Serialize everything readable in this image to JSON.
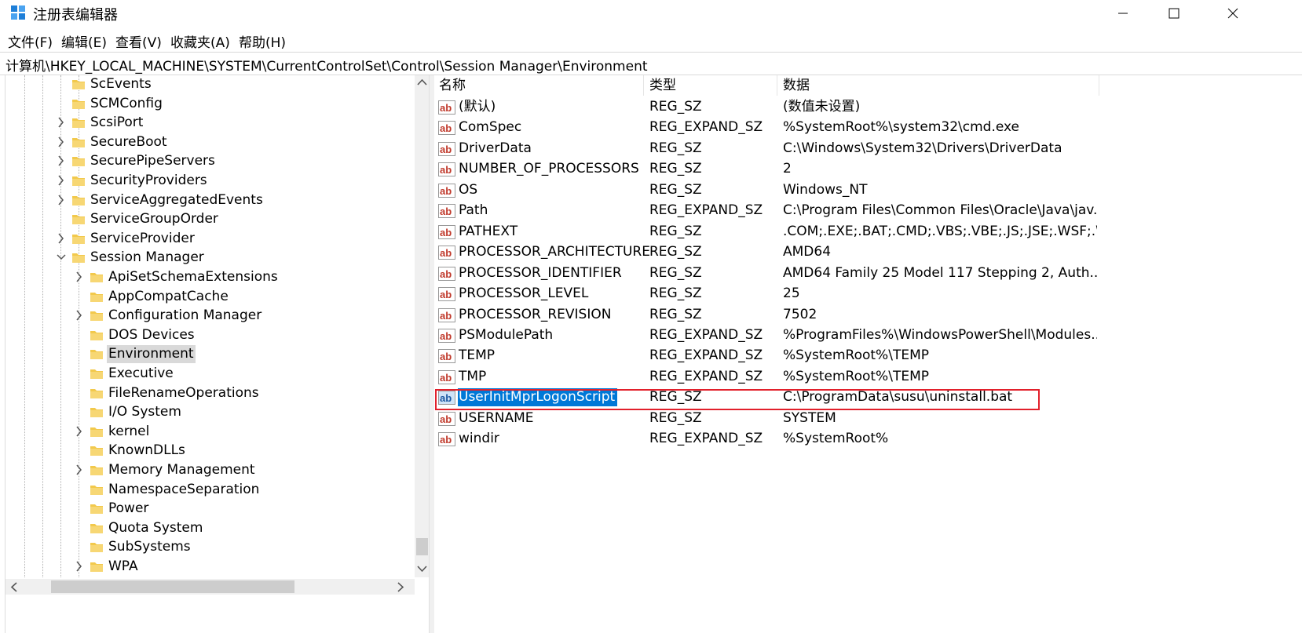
{
  "window": {
    "title": "注册表编辑器",
    "icon": "regedit-icon"
  },
  "menu": [
    "文件(F)",
    "编辑(E)",
    "查看(V)",
    "收藏夹(A)",
    "帮助(H)"
  ],
  "address": "计算机\\HKEY_LOCAL_MACHINE\\SYSTEM\\CurrentControlSet\\Control\\Session Manager\\Environment",
  "tree": [
    {
      "label": "ScEvents",
      "level": 0,
      "expander": "none"
    },
    {
      "label": "SCMConfig",
      "level": 0,
      "expander": "none"
    },
    {
      "label": "ScsiPort",
      "level": 0,
      "expander": "collapsed"
    },
    {
      "label": "SecureBoot",
      "level": 0,
      "expander": "collapsed"
    },
    {
      "label": "SecurePipeServers",
      "level": 0,
      "expander": "collapsed"
    },
    {
      "label": "SecurityProviders",
      "level": 0,
      "expander": "collapsed"
    },
    {
      "label": "ServiceAggregatedEvents",
      "level": 0,
      "expander": "collapsed"
    },
    {
      "label": "ServiceGroupOrder",
      "level": 0,
      "expander": "none"
    },
    {
      "label": "ServiceProvider",
      "level": 0,
      "expander": "collapsed"
    },
    {
      "label": "Session Manager",
      "level": 0,
      "expander": "expanded"
    },
    {
      "label": "ApiSetSchemaExtensions",
      "level": 1,
      "expander": "collapsed"
    },
    {
      "label": "AppCompatCache",
      "level": 1,
      "expander": "none"
    },
    {
      "label": "Configuration Manager",
      "level": 1,
      "expander": "collapsed"
    },
    {
      "label": "DOS Devices",
      "level": 1,
      "expander": "none"
    },
    {
      "label": "Environment",
      "level": 1,
      "expander": "none",
      "selected": true
    },
    {
      "label": "Executive",
      "level": 1,
      "expander": "none"
    },
    {
      "label": "FileRenameOperations",
      "level": 1,
      "expander": "none"
    },
    {
      "label": "I/O System",
      "level": 1,
      "expander": "none"
    },
    {
      "label": "kernel",
      "level": 1,
      "expander": "collapsed"
    },
    {
      "label": "KnownDLLs",
      "level": 1,
      "expander": "none"
    },
    {
      "label": "Memory Management",
      "level": 1,
      "expander": "collapsed"
    },
    {
      "label": "NamespaceSeparation",
      "level": 1,
      "expander": "none"
    },
    {
      "label": "Power",
      "level": 1,
      "expander": "none"
    },
    {
      "label": "Quota System",
      "level": 1,
      "expander": "none"
    },
    {
      "label": "SubSystems",
      "level": 1,
      "expander": "none"
    },
    {
      "label": "WPA",
      "level": 1,
      "expander": "collapsed"
    }
  ],
  "columns": [
    "名称",
    "类型",
    "数据"
  ],
  "values": [
    {
      "name": "(默认)",
      "type": "REG_SZ",
      "data": "(数值未设置)"
    },
    {
      "name": "ComSpec",
      "type": "REG_EXPAND_SZ",
      "data": "%SystemRoot%\\system32\\cmd.exe"
    },
    {
      "name": "DriverData",
      "type": "REG_SZ",
      "data": "C:\\Windows\\System32\\Drivers\\DriverData"
    },
    {
      "name": "NUMBER_OF_PROCESSORS",
      "type": "REG_SZ",
      "data": "2"
    },
    {
      "name": "OS",
      "type": "REG_SZ",
      "data": "Windows_NT"
    },
    {
      "name": "Path",
      "type": "REG_EXPAND_SZ",
      "data": "C:\\Program Files\\Common Files\\Oracle\\Java\\jav..."
    },
    {
      "name": "PATHEXT",
      "type": "REG_SZ",
      "data": ".COM;.EXE;.BAT;.CMD;.VBS;.VBE;.JS;.JSE;.WSF;.WS..."
    },
    {
      "name": "PROCESSOR_ARCHITECTURE",
      "type": "REG_SZ",
      "data": "AMD64"
    },
    {
      "name": "PROCESSOR_IDENTIFIER",
      "type": "REG_SZ",
      "data": "AMD64 Family 25 Model 117 Stepping 2, Auth..."
    },
    {
      "name": "PROCESSOR_LEVEL",
      "type": "REG_SZ",
      "data": "25"
    },
    {
      "name": "PROCESSOR_REVISION",
      "type": "REG_SZ",
      "data": "7502"
    },
    {
      "name": "PSModulePath",
      "type": "REG_EXPAND_SZ",
      "data": "%ProgramFiles%\\WindowsPowerShell\\Modules..."
    },
    {
      "name": "TEMP",
      "type": "REG_EXPAND_SZ",
      "data": "%SystemRoot%\\TEMP"
    },
    {
      "name": "TMP",
      "type": "REG_EXPAND_SZ",
      "data": "%SystemRoot%\\TEMP"
    },
    {
      "name": "UserInitMprLogonScript",
      "type": "REG_SZ",
      "data": "C:\\ProgramData\\susu\\uninstall.bat",
      "selected": true
    },
    {
      "name": "USERNAME",
      "type": "REG_SZ",
      "data": "SYSTEM"
    },
    {
      "name": "windir",
      "type": "REG_EXPAND_SZ",
      "data": "%SystemRoot%"
    }
  ],
  "colors": {
    "selection": "#0078d7",
    "tree_selection": "#d9d9d9",
    "highlight_box": "#e2202b",
    "folder": "#f2c94c"
  }
}
